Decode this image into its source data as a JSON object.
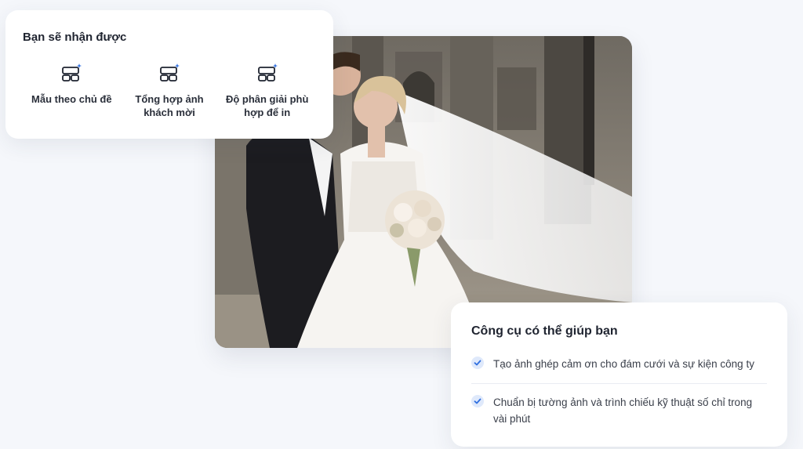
{
  "features": {
    "title": "Bạn sẽ nhận được",
    "items": [
      {
        "icon": "layout-sparkle-icon",
        "label": "Mẫu theo chủ đề"
      },
      {
        "icon": "layout-sparkle-icon",
        "label": "Tổng hợp ảnh khách mời"
      },
      {
        "icon": "layout-sparkle-icon",
        "label": "Độ phân giải phù hợp để in"
      }
    ]
  },
  "tools": {
    "title": "Công cụ có thể giúp bạn",
    "items": [
      {
        "icon": "check-icon",
        "text": "Tạo ảnh ghép cảm ơn cho đám cưới và sự kiện công ty"
      },
      {
        "icon": "check-icon",
        "text": "Chuẩn bị tường ảnh và trình chiếu kỹ thuật số chỉ trong vài phút"
      }
    ]
  },
  "colors": {
    "accent": "#2f6fe0",
    "background": "#f5f7fb",
    "card": "#ffffff"
  }
}
